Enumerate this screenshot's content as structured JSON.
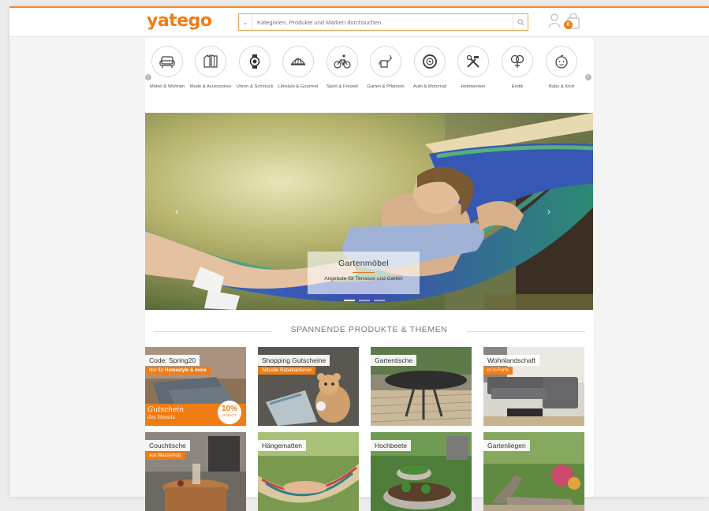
{
  "header": {
    "logo": "yatego",
    "search_placeholder": "Kategorien, Produkte und Marken durchsuchen",
    "cart_count": "0"
  },
  "categories": [
    {
      "label": "Möbel & Wohnen",
      "icon": "armchair-icon"
    },
    {
      "label": "Mode & Accessoires",
      "icon": "clothing-icon"
    },
    {
      "label": "Uhren & Schmuck",
      "icon": "watch-icon"
    },
    {
      "label": "Lifestyle & Gourmet",
      "icon": "food-icon"
    },
    {
      "label": "Sport & Freizeit",
      "icon": "bicycle-icon"
    },
    {
      "label": "Garten & Pflanzen",
      "icon": "watering-can-icon"
    },
    {
      "label": "Auto & Motorrad",
      "icon": "tire-icon"
    },
    {
      "label": "Heimwerker",
      "icon": "tools-icon"
    },
    {
      "label": "Erotik",
      "icon": "erotic-icon"
    },
    {
      "label": "Baby & Kind",
      "icon": "baby-icon"
    }
  ],
  "hero": {
    "title": "Gartenmöbel",
    "subtitle": "Angebote für Terrasse und Garten",
    "active_slide": 1,
    "slide_count": 3
  },
  "section": {
    "title": "SPANNENDE PRODUKTE & THEMEN"
  },
  "tiles": [
    {
      "label": "Code: Spring20",
      "tag_pre": "Nur für ",
      "tag_bold": "Homestyle & more",
      "promo_word": "Gutschein",
      "promo_small": "des Monats",
      "badge_pct": "10%",
      "badge_text": "RABATT"
    },
    {
      "label": "Shopping Gutscheine",
      "tag": "Aktuelle Rabattaktionen"
    },
    {
      "label": "Gartentische"
    },
    {
      "label": "Wohnlandschaft",
      "tag": "in U-Form"
    },
    {
      "label": "Couchtische",
      "tag": "aus Massivholz"
    },
    {
      "label": "Hängematten"
    },
    {
      "label": "Hochbeete"
    },
    {
      "label": "Gartenliegen"
    }
  ]
}
